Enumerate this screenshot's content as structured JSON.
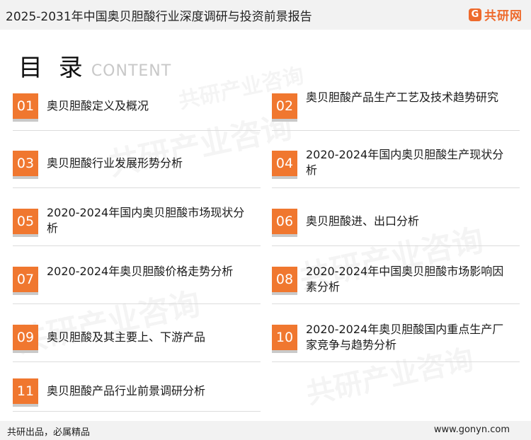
{
  "header": {
    "title": "2025-2031年中国奥贝胆酸行业深度调研与投资前景报告",
    "logo_mark": "G",
    "logo_text": "共研网"
  },
  "toc": {
    "title": "目 录",
    "subtitle": "CONTENT"
  },
  "watermark_text": "共研产业咨询",
  "items": [
    {
      "num": "01",
      "text": "奥贝胆酸定义及概况"
    },
    {
      "num": "02",
      "text": "奥贝胆酸产品生产工艺及技术趋势研究"
    },
    {
      "num": "03",
      "text": "奥贝胆酸行业发展形势分析"
    },
    {
      "num": "04",
      "text": "2020-2024年国内奥贝胆酸生产现状分析"
    },
    {
      "num": "05",
      "text": "2020-2024年国内奥贝胆酸市场现状分析"
    },
    {
      "num": "06",
      "text": "奥贝胆酸进、出口分析"
    },
    {
      "num": "07",
      "text": "2020-2024年奥贝胆酸价格走势分析"
    },
    {
      "num": "08",
      "text": "2020-2024年中国奥贝胆酸市场影响因素分析"
    },
    {
      "num": "09",
      "text": "奥贝胆酸及其主要上、下游产品"
    },
    {
      "num": "10",
      "text": "2020-2024年奥贝胆酸国内重点生产厂家竞争与趋势分析"
    },
    {
      "num": "11",
      "text": "奥贝胆酸产品行业前景调研分析"
    }
  ],
  "footer": {
    "slogan": "共研出品，必属精品",
    "website": "www.gonyn.com"
  }
}
